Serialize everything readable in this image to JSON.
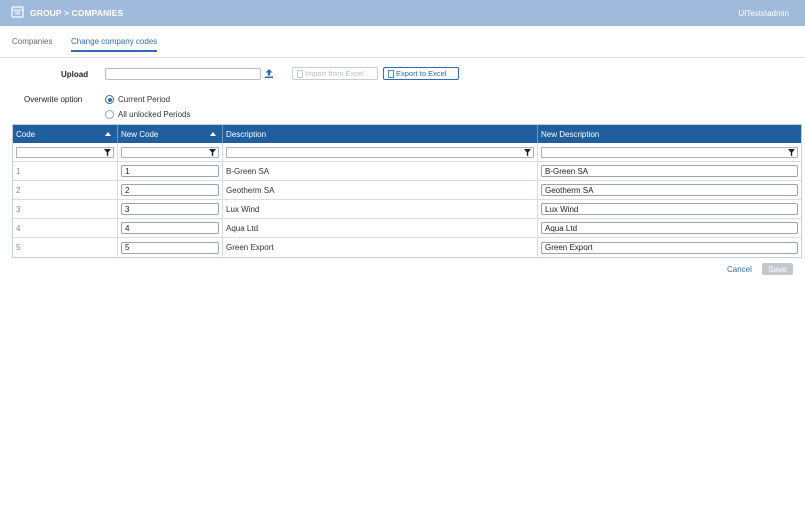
{
  "header": {
    "breadcrumb": "GROUP > COMPANIES",
    "user": "UITests\\admin"
  },
  "tabs": [
    {
      "label": "Companies",
      "active": false
    },
    {
      "label": "Change company codes",
      "active": true
    }
  ],
  "form": {
    "upload_label": "Upload",
    "upload_value": "",
    "import_button": "Import from Excel",
    "export_button": "Export to Excel",
    "overwrite_label": "Overwrite option",
    "options": [
      {
        "label": "Current Period",
        "selected": true
      },
      {
        "label": "All unlocked Periods",
        "selected": false
      }
    ]
  },
  "grid": {
    "columns": [
      "Code",
      "New Code",
      "Description",
      "New Description"
    ],
    "rows": [
      {
        "code": "1",
        "new_code": "1",
        "description": "B-Green SA",
        "new_description": "B-Green SA"
      },
      {
        "code": "2",
        "new_code": "2",
        "description": "Geotherm SA",
        "new_description": "Geotherm SA"
      },
      {
        "code": "3",
        "new_code": "3",
        "description": "Lux Wind",
        "new_description": "Lux Wind"
      },
      {
        "code": "4",
        "new_code": "4",
        "description": "Aqua Ltd",
        "new_description": "Aqua Ltd"
      },
      {
        "code": "5",
        "new_code": "5",
        "description": "Green Export",
        "new_description": "Green Export"
      }
    ]
  },
  "actions": {
    "cancel": "Cancel",
    "save": "Save"
  },
  "colors": {
    "header_bar": "#9fbadb",
    "grid_header": "#1f5f9f",
    "accent": "#2e6db4"
  }
}
